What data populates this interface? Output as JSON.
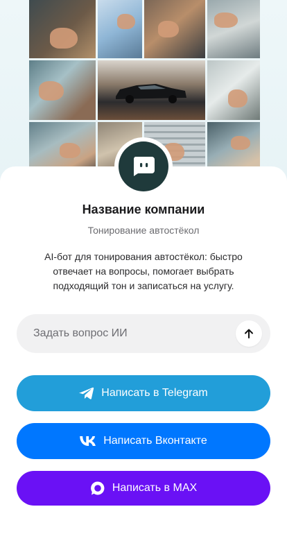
{
  "company": {
    "name": "Название компании",
    "subtitle": "Тонирование автостёкол",
    "description": "AI-бот для тонирования автостёкол: быстро отвечает на вопросы, помогает выбрать подходящий тон и записаться на услугу."
  },
  "ask": {
    "placeholder": "Задать вопрос ИИ",
    "send_icon": "arrow-up-icon"
  },
  "buttons": {
    "telegram": {
      "label": "Написать в Telegram",
      "color": "#229ED9",
      "icon": "telegram-icon"
    },
    "vk": {
      "label": "Написать Вконтакте",
      "color": "#0077FF",
      "icon": "vk-icon"
    },
    "max": {
      "label": "Написать в MAX",
      "color": "#6A11F5",
      "icon": "max-icon"
    }
  },
  "colors": {
    "avatar_bg": "#1F3A3B",
    "input_bg": "#F1F1F2"
  }
}
